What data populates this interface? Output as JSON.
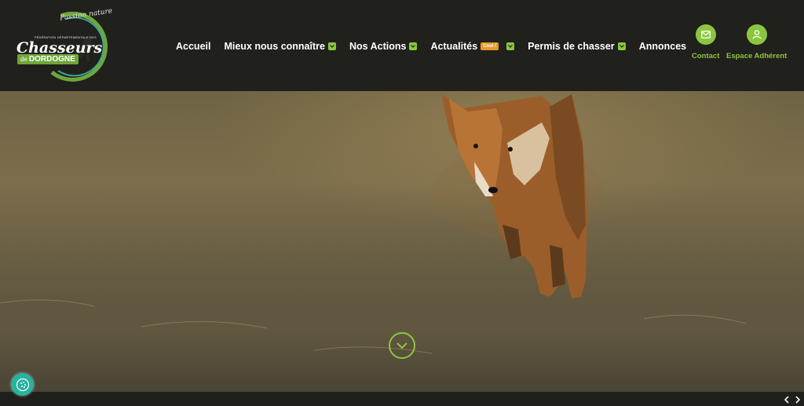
{
  "logo": {
    "tagline": "Passion nature",
    "federation": "FÉDÉRATION DÉPARTEMENTALE DES",
    "main": "Chasseurs",
    "badge_prefix": "de",
    "badge": "DORDOGNE"
  },
  "nav": {
    "items": [
      {
        "label": "Accueil"
      },
      {
        "label": "Mieux nous connaître"
      },
      {
        "label": "Nos Actions"
      },
      {
        "label": "Actualités",
        "badge": "Cool !"
      },
      {
        "label": "Permis de chasser"
      },
      {
        "label": "Annonces"
      }
    ]
  },
  "actions": {
    "contact": "Contact",
    "member": "Espace Adhérent"
  },
  "colors": {
    "accent": "#8cc63f",
    "header_bg": "#20201d",
    "badge": "#e8962c",
    "accessibility": "#29b2a0"
  },
  "icons": {
    "contact": "envelope-icon",
    "member": "user-icon",
    "scroll": "chevron-down-icon",
    "prev": "chevron-left-icon",
    "next": "chevron-right-icon",
    "accessibility": "accessibility-icon"
  }
}
